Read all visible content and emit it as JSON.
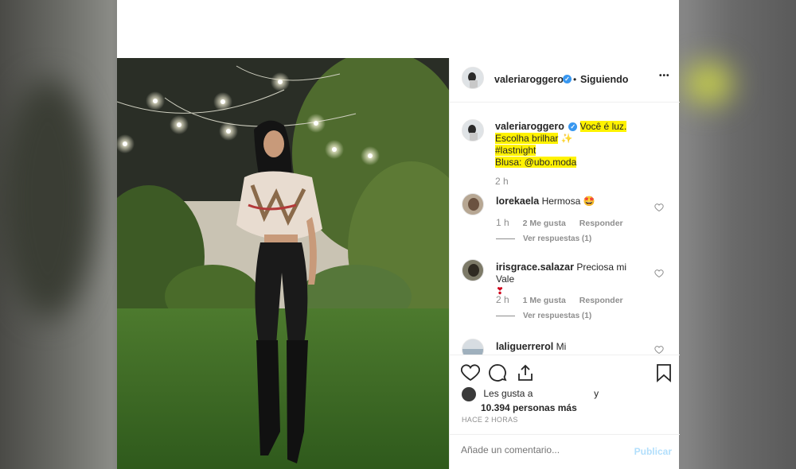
{
  "post": {
    "username": "valeriaroggero",
    "follow_status": "Siguiendo",
    "more_label": "•••"
  },
  "caption": {
    "username": "valeriaroggero",
    "line1": "Você é luz.",
    "line2": "Escolha brilhar",
    "line2_emoji": "✨",
    "line3": "#lastnight",
    "line4": "Blusa: @ubo.moda",
    "time": "2 h"
  },
  "comments": [
    {
      "username": "lorekaela",
      "text": "Hermosa",
      "emoji": "🤩",
      "time": "1 h",
      "likes": "2 Me gusta",
      "reply": "Responder",
      "view_replies": "Ver respuestas (1)"
    },
    {
      "username": "irisgrace.salazar",
      "text": "Preciosa mi Vale",
      "emoji": "❣",
      "time": "2 h",
      "likes": "1 Me gusta",
      "reply": "Responder",
      "view_replies": "Ver respuestas (1)"
    },
    {
      "username": "laliguerrerol",
      "text": "Mi"
    }
  ],
  "likes": {
    "prefix": "Les gusta a",
    "conjunction": "y",
    "count_text": "10.394 personas más"
  },
  "timestamp": "HACE 2 HORAS",
  "add_comment": {
    "placeholder": "Añade un comentario...",
    "publish": "Publicar"
  },
  "colors": {
    "highlight": "#fff200",
    "verified": "#3897f0",
    "publish_disabled": "#b2dffc",
    "muted": "#8e8e8e"
  }
}
